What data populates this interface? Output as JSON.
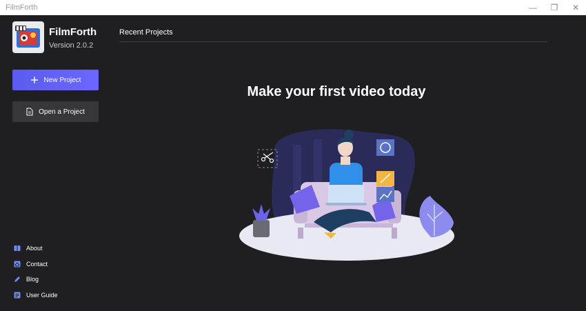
{
  "window": {
    "title": "FilmForth",
    "controls": {
      "minimize": "—",
      "restore": "❐",
      "close": "✕"
    }
  },
  "brand": {
    "name": "FilmForth",
    "version": "Version  2.0.2"
  },
  "actions": {
    "new_project": "New Project",
    "open_project": "Open a Project"
  },
  "recent": {
    "heading": "Recent Projects"
  },
  "empty_state": {
    "headline": "Make your first video today"
  },
  "footer_links": [
    {
      "label": "About",
      "icon": "book-icon"
    },
    {
      "label": "Contact",
      "icon": "home-icon"
    },
    {
      "label": "Blog",
      "icon": "pen-icon"
    },
    {
      "label": "User Guide",
      "icon": "guide-icon"
    }
  ],
  "colors": {
    "accent": "#5b5ef2",
    "background": "#1f1f21",
    "secondary_button": "#37373b",
    "link_icon": "#6f8cff"
  }
}
